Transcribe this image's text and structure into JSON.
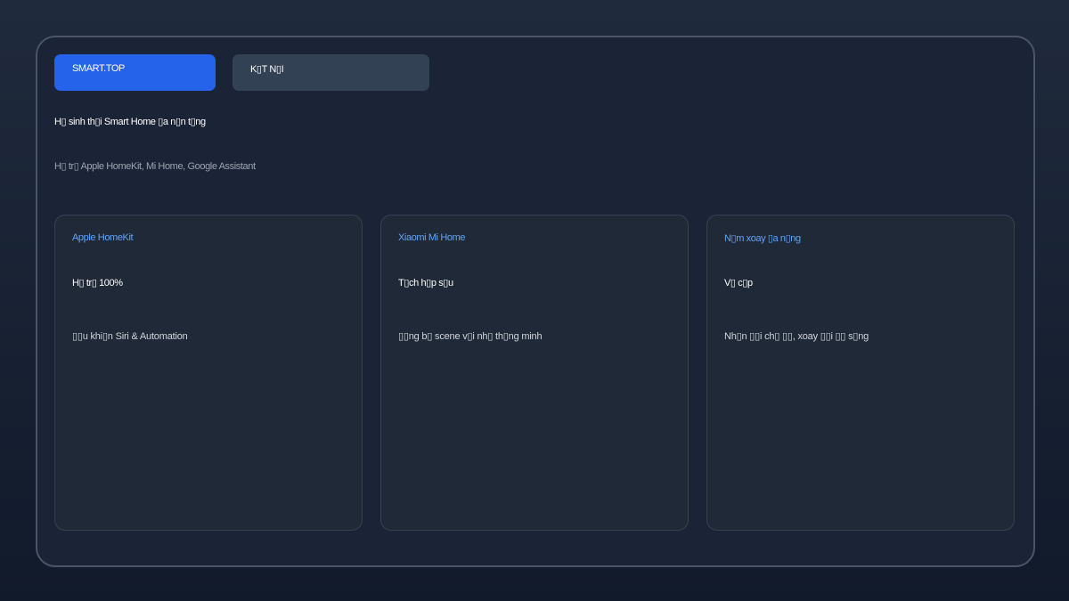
{
  "tabs": {
    "brand_label": "SMART.TOP",
    "connect_label": "K▯T N▯I"
  },
  "hero": {
    "headline": "H▯ sinh th▯i Smart Home ▯a n▯n t▯ng",
    "subline": "H▯ tr▯ Apple HomeKit, Mi Home, Google Assistant"
  },
  "cards": [
    {
      "title": "Apple HomeKit",
      "value": "H▯ tr▯ 100%",
      "description": "▯▯u khi▯n Siri & Automation"
    },
    {
      "title": "Xiaomi Mi Home",
      "value": "T▯ch h▯p s▯u",
      "description": "▯▯ng b▯ scene v▯i nh▯ th▯ng minh"
    },
    {
      "title": "N▯m xoay ▯a n▯ng",
      "value": "V▯ c▯p",
      "description": "Nh▯n ▯▯i ch▯ ▯▯, xoay ▯▯i ▯▯ s▯ng"
    }
  ],
  "colors": {
    "accent": "#2563eb",
    "card_title": "#60a5fa",
    "tab_inactive": "#334155"
  }
}
